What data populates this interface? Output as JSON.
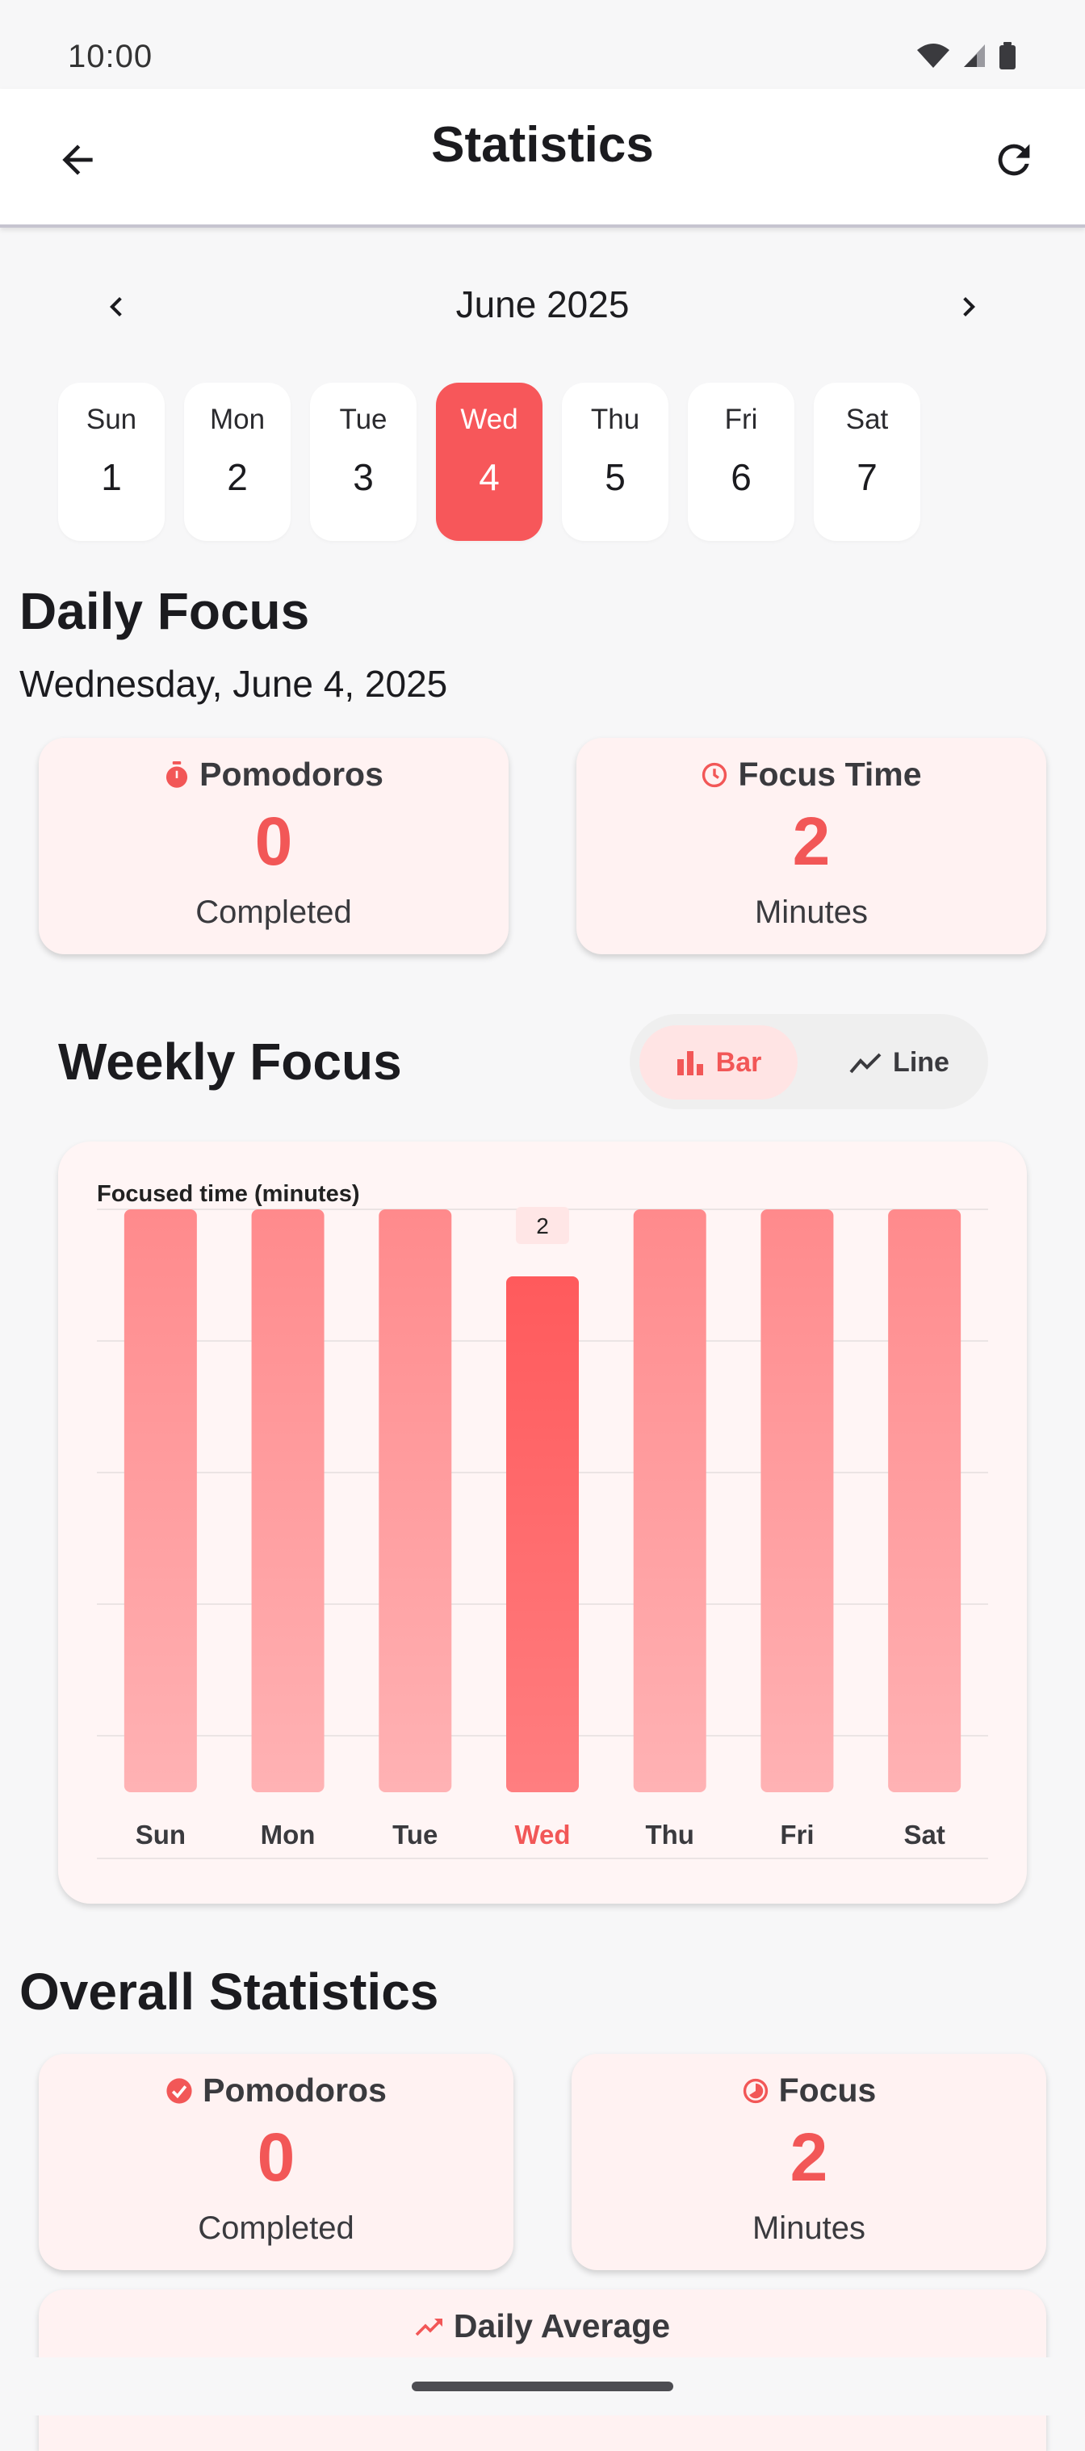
{
  "status": {
    "time": "10:00"
  },
  "appbar": {
    "title": "Statistics"
  },
  "calendar": {
    "month_label": "June 2025",
    "days": [
      {
        "name": "Sun",
        "num": "1"
      },
      {
        "name": "Mon",
        "num": "2"
      },
      {
        "name": "Tue",
        "num": "3"
      },
      {
        "name": "Wed",
        "num": "4"
      },
      {
        "name": "Thu",
        "num": "5"
      },
      {
        "name": "Fri",
        "num": "6"
      },
      {
        "name": "Sat",
        "num": "7"
      }
    ],
    "selected_index": 3
  },
  "daily": {
    "title": "Daily Focus",
    "date": "Wednesday, June 4, 2025",
    "pomodoros": {
      "label": "Pomodoros",
      "value": "0",
      "unit": "Completed"
    },
    "focus_time": {
      "label": "Focus Time",
      "value": "2",
      "unit": "Minutes"
    }
  },
  "weekly": {
    "title": "Weekly Focus",
    "toggle": {
      "bar_label": "Bar",
      "line_label": "Line",
      "active": "Bar"
    }
  },
  "chart_data": {
    "type": "bar",
    "ylabel": "Focused time (minutes)",
    "categories": [
      "Sun",
      "Mon",
      "Tue",
      "Wed",
      "Thu",
      "Fri",
      "Sat"
    ],
    "values": [
      null,
      null,
      null,
      2,
      null,
      null,
      null
    ],
    "highlight_index": 3,
    "ylim": [
      0,
      2.26
    ],
    "grid": true,
    "value_label": "2"
  },
  "overall": {
    "title": "Overall Statistics",
    "pomodoros": {
      "label": "Pomodoros",
      "value": "0",
      "unit": "Completed"
    },
    "focus": {
      "label": "Focus",
      "value": "2",
      "unit": "Minutes"
    },
    "daily_average": {
      "label": "Daily Average"
    }
  },
  "colors": {
    "accent": "#f25757",
    "card_bg": "#fff2f2",
    "page_bg": "#f7f7f8"
  }
}
